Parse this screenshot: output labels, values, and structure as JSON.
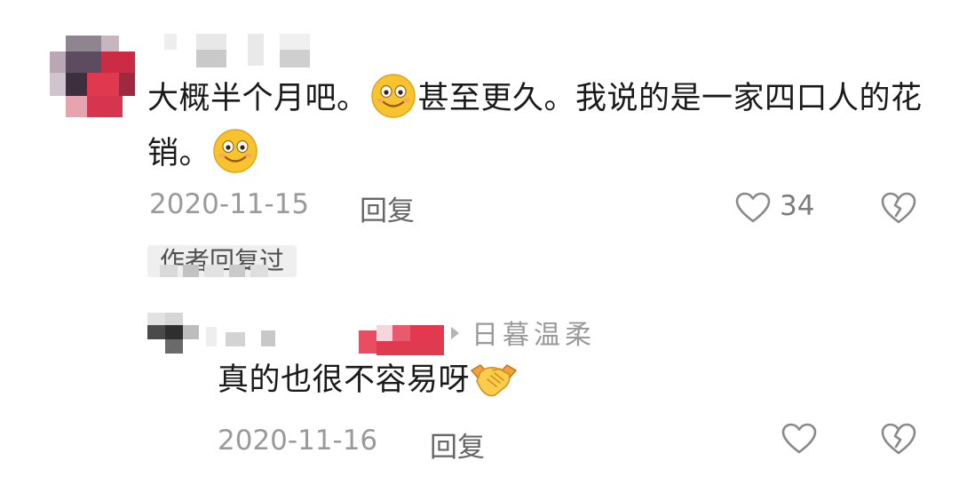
{
  "comment": {
    "text_part1": "大概半个月吧。",
    "text_part2": "甚至更久。我说的是一家四口人的花销。",
    "date": "2020-11-15",
    "reply_label": "回复",
    "like_count": "34",
    "author_badge": "作者回复过"
  },
  "reply": {
    "reply_to_name": "日暮温柔",
    "text": "真的也很不容易呀",
    "date": "2020-11-16",
    "reply_label": "回复"
  },
  "icons": {
    "emoji": "smiling-face-emoji",
    "handshake": "handshake-emoji",
    "like": "heart-outline-icon",
    "dislike": "broken-heart-icon"
  },
  "colors": {
    "text_primary": "#1a1a1a",
    "text_secondary": "#9a9a9a",
    "icon_gray": "#8a8a8a",
    "emoji_yellow": "#f7c42f"
  }
}
